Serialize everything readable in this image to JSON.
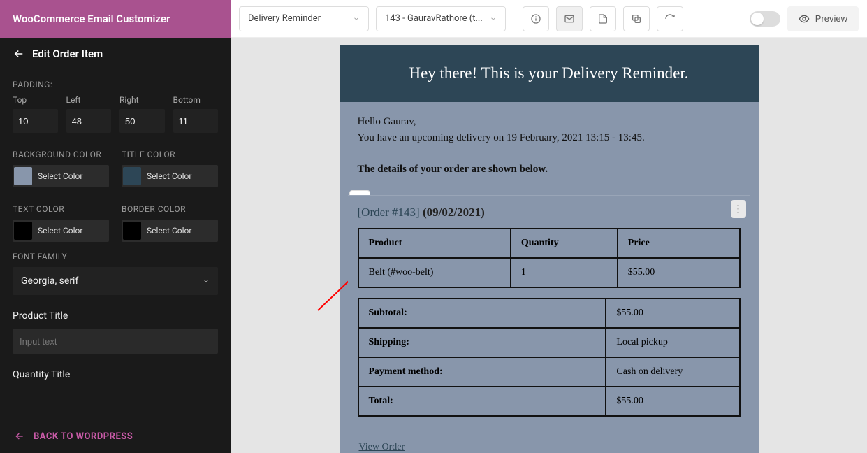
{
  "header": {
    "title": "WooCommerce Email Customizer"
  },
  "sidebar": {
    "edit_title": "Edit Order Item",
    "padding_label": "PADDING:",
    "padding": {
      "top_label": "Top",
      "top": "10",
      "left_label": "Left",
      "left": "48",
      "right_label": "Right",
      "right": "50",
      "bottom_label": "Bottom",
      "bottom": "11"
    },
    "bg_label": "BACKGROUND COLOR",
    "title_color_label": "TITLE COLOR",
    "text_color_label": "TEXT COLOR",
    "border_color_label": "BORDER COLOR",
    "select_color": "Select Color",
    "colors": {
      "bg": "#8896ab",
      "title": "#2d4656",
      "text": "#000000",
      "border": "#000000"
    },
    "font_label": "FONT FAMILY",
    "font_value": "Georgia, serif",
    "product_title_label": "Product Title",
    "product_title_placeholder": "Input text",
    "product_title_value": "",
    "quantity_title_label": "Quantity Title",
    "back_label": "BACK TO WORDPRESS"
  },
  "topbar": {
    "template_select": "Delivery Reminder",
    "order_select": "143 - GauravRathore (t...",
    "preview_label": "Preview"
  },
  "email": {
    "heading": "Hey there! This is your Delivery Reminder.",
    "greeting": "Hello Gaurav,",
    "line1": "You have an upcoming delivery on 19 February, 2021 13:15 - 13:45.",
    "details_label": "The details of your order are shown below.",
    "order_link": "[Order #143]",
    "order_date": "(09/02/2021)",
    "cols": {
      "product": "Product",
      "qty": "Quantity",
      "price": "Price"
    },
    "items": [
      {
        "product": "Belt (#woo-belt)",
        "qty": "1",
        "price": "$55.00"
      }
    ],
    "totals": [
      {
        "label": "Subtotal:",
        "value": "$55.00"
      },
      {
        "label": "Shipping:",
        "value": "Local pickup"
      },
      {
        "label": "Payment method:",
        "value": "Cash on delivery"
      },
      {
        "label": "Total:",
        "value": "$55.00"
      }
    ],
    "view_order": "View Order"
  }
}
